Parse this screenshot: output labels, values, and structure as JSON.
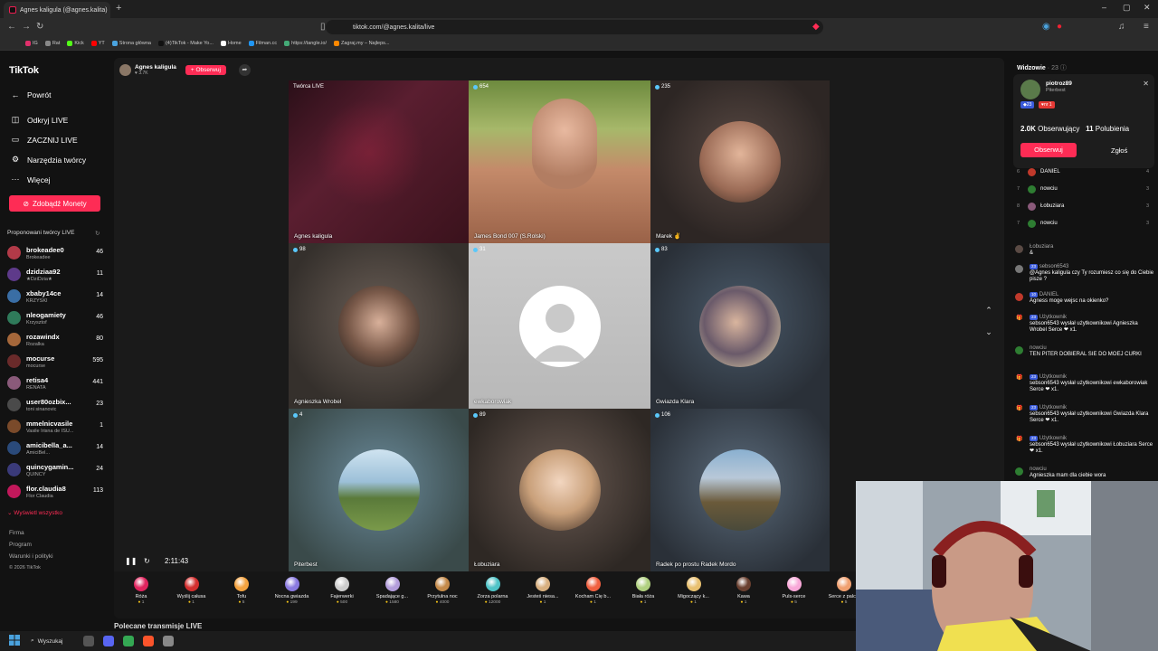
{
  "browser": {
    "tab_title": "Agnes kaligula (@agnes.kalita)",
    "url": "tiktok.com/@agnes.kalita/live",
    "bookmarks": [
      "IG",
      "Rat",
      "Kick",
      "YT",
      "Strona główna",
      "(4)TikTok - Make Yo...",
      "Home",
      "Filman.cc",
      "https://tangle.io/",
      "Zagraj.my – Najleps..."
    ]
  },
  "sidebar": {
    "logo": "TikTok",
    "nav": [
      {
        "label": "Powrót",
        "icon": "arrow-left-icon"
      },
      {
        "label": "Odkryj LIVE",
        "icon": "live-icon"
      },
      {
        "label": "ZACZNIJ LIVE",
        "icon": "camera-icon"
      },
      {
        "label": "Narzędzia twórcy",
        "icon": "tools-icon"
      },
      {
        "label": "Więcej",
        "icon": "more-icon"
      }
    ],
    "coins_button": "Zdobądź Monety",
    "suggested_title": "Proponowani twórcy LIVE",
    "creators": [
      {
        "name": "brokeadee0",
        "sub": "Brokeadee",
        "count": "46",
        "color": "#b23a48"
      },
      {
        "name": "dzidziaa92",
        "sub": "★DziDzia★",
        "count": "11",
        "color": "#5e3a8a"
      },
      {
        "name": "xbaby14ce",
        "sub": "KRZYŚKI",
        "count": "14",
        "color": "#3a6ea5"
      },
      {
        "name": "nleogamiety",
        "sub": "Krzysztof",
        "count": "46",
        "color": "#2f7a5a"
      },
      {
        "name": "rozawindx",
        "sub": "Rozalka",
        "count": "80",
        "color": "#a5673a"
      },
      {
        "name": "mocurse",
        "sub": "mocurse",
        "count": "595",
        "color": "#6a2a2a"
      },
      {
        "name": "retisa4",
        "sub": "RENATA",
        "count": "441",
        "color": "#8a5a7a"
      },
      {
        "name": "user80ozbix...",
        "sub": "toni sinanovic",
        "count": "23",
        "color": "#4a4a4a"
      },
      {
        "name": "mmelnicvasile",
        "sub": "Vasile Irisna de ISU...",
        "count": "1",
        "color": "#7a4a2a"
      },
      {
        "name": "amicibella_a...",
        "sub": "AmiciBel...",
        "count": "14",
        "color": "#2a4a7a"
      },
      {
        "name": "quincygamin...",
        "sub": "QUINCY",
        "count": "24",
        "color": "#3a3a7a"
      },
      {
        "name": "flor.claudia8",
        "sub": "Flor Claudia",
        "count": "113",
        "color": "#c2185b"
      }
    ],
    "show_all": "Wyświetl wszystko",
    "footer": [
      "Firma",
      "Program",
      "Warunki i polityki",
      "© 2026 TikTok"
    ]
  },
  "host": {
    "name": "Agnes kaligula",
    "likes": "3.7K",
    "follow": "+ Obserwuj"
  },
  "tiles": [
    {
      "label": "Agnes kaligula",
      "count": "Twórca LIVE",
      "bg": "linear-gradient(135deg,#2a0f18 0%,#5a1e30 40%,#3a121c 100%)",
      "kind": "photo"
    },
    {
      "label": "James Bond 007 (S.Rolski)",
      "count": "654",
      "bg": "linear-gradient(180deg,#6d8a3e 0%,#a7b86a 30%,#c48a6a 55%,#9a6248 100%)",
      "kind": "face"
    },
    {
      "label": "Marek ✌️",
      "count": "235",
      "bg": "radial-gradient(circle at 50% 45%,#5a4a44 0%,#2d2624 70%)",
      "kind": "avatar",
      "av": "radial-gradient(circle at 50% 40%,#e2b59a 0%,#9a6a55 60%,#3a2a22 100%)"
    },
    {
      "label": "Agnieszka Wrobel",
      "count": "98",
      "bg": "radial-gradient(circle at 50% 45%,#6a5e56 0%,#35302c 75%)",
      "kind": "avatar",
      "av": "radial-gradient(circle at 50% 45%,#d8b09a 0%,#7a5a4a 50%,#1e1a18 100%)"
    },
    {
      "label": "ewkaborowiak",
      "count": "31",
      "bg": "linear-gradient(180deg,#c9c9c9 0%,#b8b8b8 100%)",
      "kind": "blank"
    },
    {
      "label": "Gwiazda Klara",
      "count": "83",
      "bg": "radial-gradient(circle at 50% 45%,#4a5a6a 0%,#2a3038 75%)",
      "kind": "avatar",
      "av": "radial-gradient(circle at 45% 45%,#d9b59e 0%,#6a5a6a 50%,#f0e0b0 100%)"
    },
    {
      "label": "Piterbest",
      "count": "4",
      "bg": "radial-gradient(circle at 50% 45%,#6a8a9a 0%,#3a4a4a 80%)",
      "kind": "avatar",
      "av": "linear-gradient(180deg,#cfe3f0 0%,#9cc0d8 40%,#5a7a3a 60%,#7a9a4a 100%)"
    },
    {
      "label": "Łobuziara",
      "count": "89",
      "bg": "radial-gradient(circle at 50% 45%,#6a5a52 0%,#2e2824 80%)",
      "kind": "avatar",
      "av": "radial-gradient(circle at 50% 40%,#f2d6c0 0%,#c9a07a 50%,#3a2a22 100%)"
    },
    {
      "label": "Radek po prostu Radek Mordo",
      "count": "106",
      "bg": "radial-gradient(circle at 50% 45%,#5a6a7a 0%,#2a3038 80%)",
      "kind": "avatar",
      "av": "linear-gradient(180deg,#8ab0d0 0%,#b8c8d8 35%,#6a5a3a 65%,#4a4a3a 100%)"
    }
  ],
  "controls": {
    "time": "2:11:43"
  },
  "gifts": [
    {
      "name": "Róża",
      "price": "1",
      "color": "#e0245e"
    },
    {
      "name": "Wyślij całusa",
      "price": "1",
      "color": "#d32f2f"
    },
    {
      "name": "Tofu",
      "price": "5",
      "color": "#f4a340"
    },
    {
      "name": "Nocna gwiazda",
      "price": "199",
      "color": "#8a7ae0"
    },
    {
      "name": "Fajerwerki",
      "price": "500",
      "color": "#cccccc"
    },
    {
      "name": "Spadające g...",
      "price": "1580",
      "color": "#b39ddb"
    },
    {
      "name": "Przytulna noc",
      "price": "4000",
      "color": "#c48a4a"
    },
    {
      "name": "Zorza polarna",
      "price": "12000",
      "color": "#4fc3c7"
    },
    {
      "name": "Jesteś niesa...",
      "price": "1",
      "color": "#d8b080"
    },
    {
      "name": "Kocham Cię b...",
      "price": "1",
      "color": "#f06040"
    },
    {
      "name": "Biała róża",
      "price": "1",
      "color": "#b0d080"
    },
    {
      "name": "Migoczący k...",
      "price": "1",
      "color": "#e8c070"
    },
    {
      "name": "Kawa",
      "price": "1",
      "color": "#6a4030"
    },
    {
      "name": "Puls-serce",
      "price": "5",
      "color": "#f8a8d8"
    },
    {
      "name": "Serce z palc...",
      "price": "5",
      "color": "#f0a070"
    }
  ],
  "recommended": "Polecane transmisje LIVE",
  "viewers_panel": {
    "title": "Widzowie",
    "count": "23",
    "user": {
      "name": "piotroz89",
      "sub": "Piterbest",
      "badge1": "23",
      "badge2": "nr 1"
    },
    "followers": "2.0K",
    "followers_label": "Obserwujący",
    "likes": "11",
    "likes_label": "Polubienia",
    "follow_button": "Obserwuj",
    "report": "Zgłoś",
    "ranking": [
      {
        "n": "6",
        "name": "DANIEL",
        "score": "4",
        "color": "#c0392b"
      },
      {
        "n": "7",
        "name": "nowciu",
        "score": "3",
        "color": "#2e7d32"
      },
      {
        "n": "8",
        "name": "Łobuziara",
        "score": "3",
        "color": "#8a5a7a"
      },
      {
        "n": "7",
        "name": "nowciu",
        "score": "3",
        "color": "#2e7d32"
      }
    ]
  },
  "chat": [
    {
      "user": "Łobuziara",
      "text": "&",
      "color": "#5a4a44"
    },
    {
      "user": "sebson6543",
      "text": "@Agnes kaligula czy Ty rozumiesz co się do Ciebie pisze ?",
      "color": "#777",
      "pill": "23"
    },
    {
      "user": "DANIEL",
      "text": "Agness moge wejsc na okienko?",
      "color": "#c0392b",
      "pill": "10"
    },
    {
      "user": "Użytkownik",
      "text": "sebson6543 wysłał użytkownikowi Agnieszka Wrobel Serce ❤ x1.",
      "gift": true,
      "pill": "23"
    },
    {
      "user": "nowciu",
      "text": "TEN PITER DOBIERAL SIE DO MOEJ CURKI",
      "color": "#2e7d32"
    },
    {
      "user": "Użytkownik",
      "text": "sebson6543 wysłał użytkownikowi ewkaborowiak Serce ❤ x1.",
      "gift": true,
      "pill": "23"
    },
    {
      "user": "Użytkownik",
      "text": "sebson6543 wysłał użytkownikowi Gwiazda Klara Serce ❤ x1.",
      "gift": true,
      "pill": "23"
    },
    {
      "user": "Użytkownik",
      "text": "sebson6543 wysłał użytkownikowi Łobuziara Serce ❤ x1.",
      "gift": true,
      "pill": "23"
    },
    {
      "user": "nowciu",
      "text": "Agnieszka mam dla ciebie wora",
      "color": "#2e7d32"
    }
  ],
  "taskbar": {
    "search": "Wyszukaj"
  }
}
